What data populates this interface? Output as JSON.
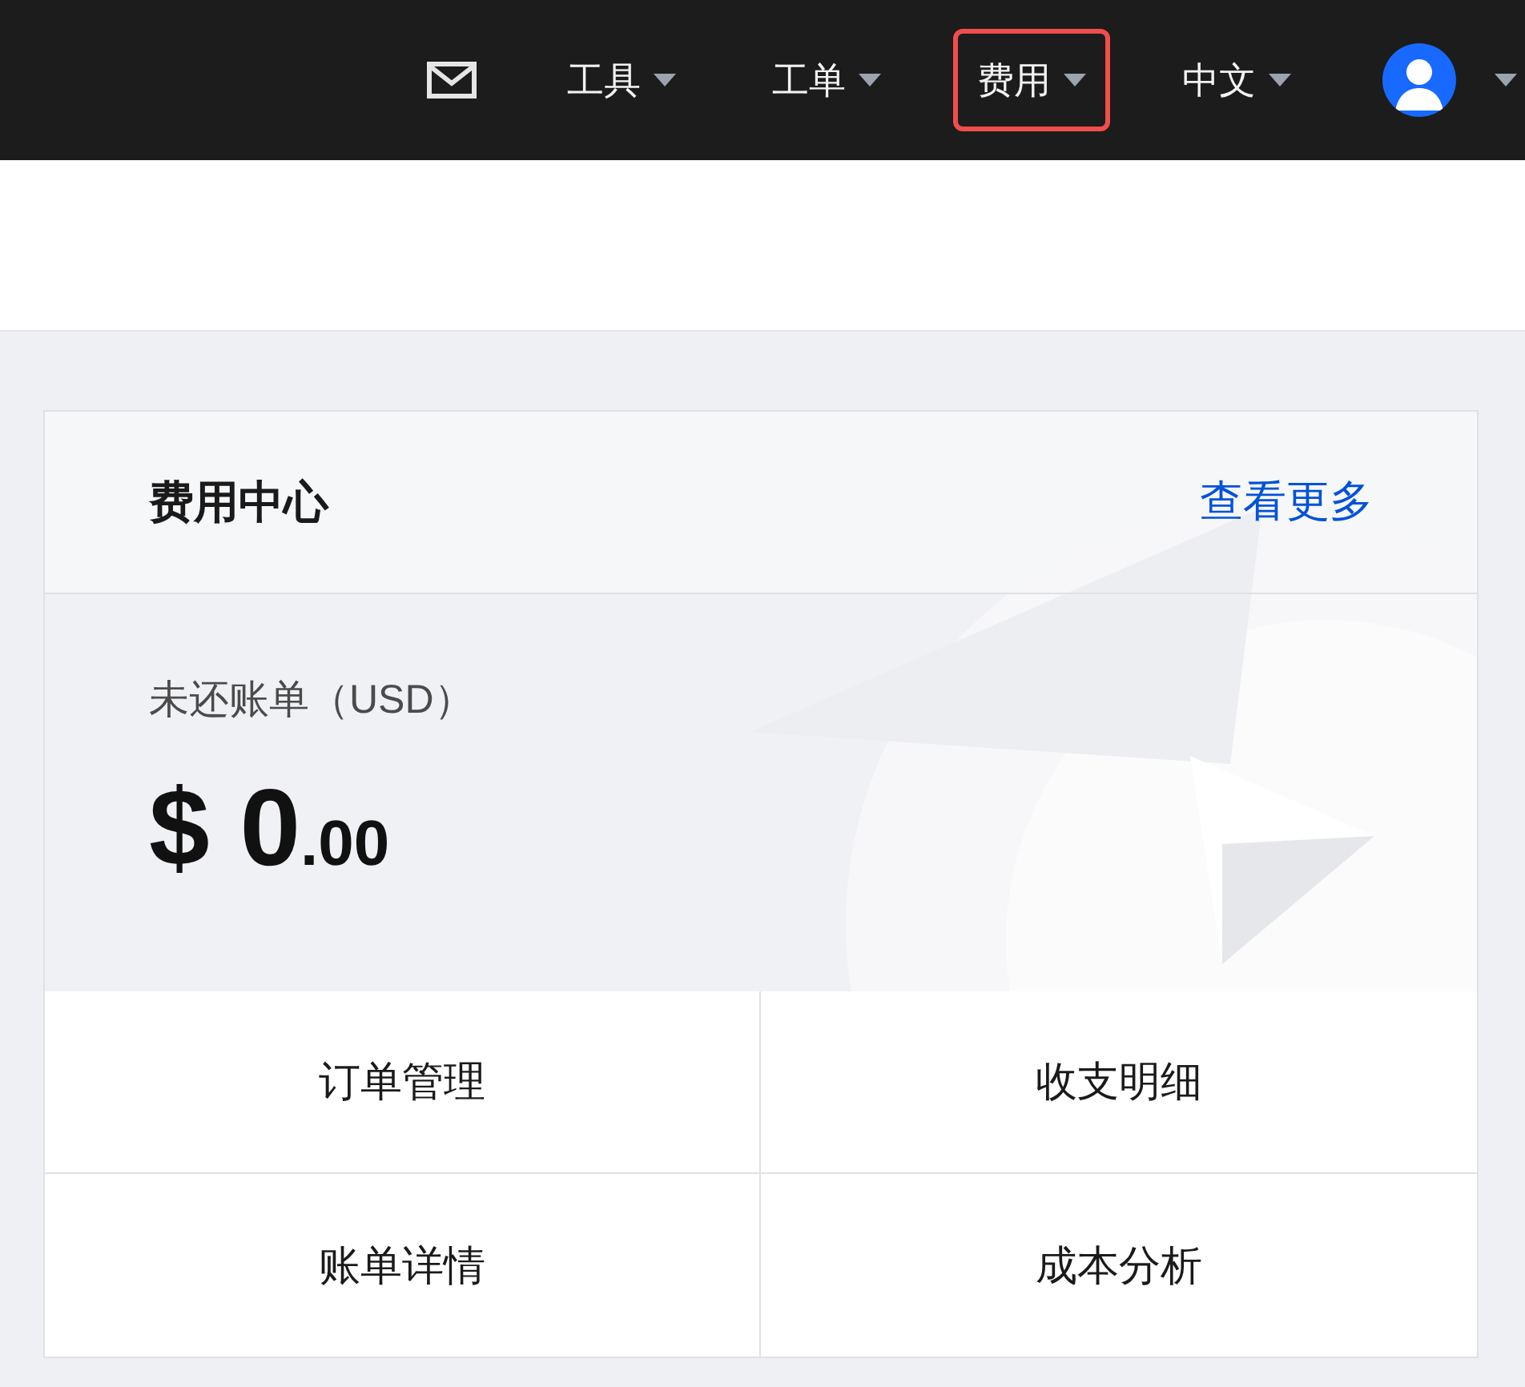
{
  "top_bar": {
    "menu": [
      {
        "label": "工具",
        "highlighted": false
      },
      {
        "label": "工单",
        "highlighted": false
      },
      {
        "label": "费用",
        "highlighted": true
      },
      {
        "label": "中文",
        "highlighted": false
      }
    ]
  },
  "card": {
    "title": "费用中心",
    "more_link": "查看更多",
    "balance_label": "未还账单（USD）",
    "amount": {
      "integer": "$ 0",
      "decimals": ".00"
    },
    "links": [
      "订单管理",
      "收支明细",
      "账单详情",
      "成本分析"
    ]
  }
}
